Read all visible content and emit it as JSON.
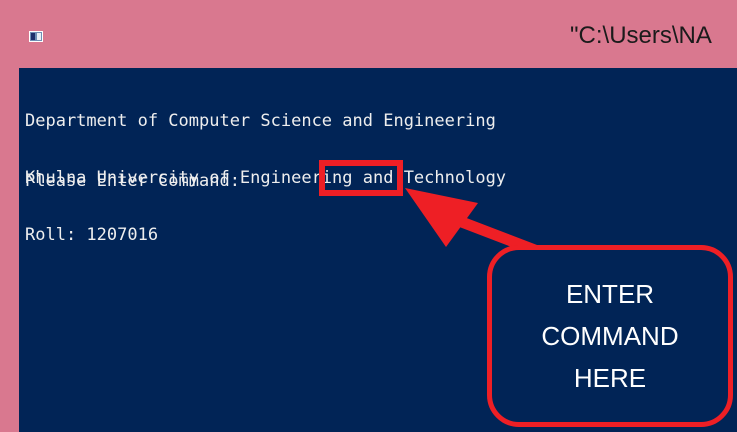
{
  "window": {
    "title": "\"C:\\Users\\NA",
    "icon": "console-app-icon"
  },
  "console": {
    "lines": [
      "Department of Computer Science and Engineering",
      "Khulna University of Engineering and Technology",
      "Roll: 1207016"
    ],
    "prompt": "Please Enter Command:",
    "input_value": ""
  },
  "callout": {
    "line1": "ENTER",
    "line2": "COMMAND",
    "line3": "HERE"
  },
  "colors": {
    "title_bar": "#d9788f",
    "console_background": "#012456",
    "console_text": "#eeeeee",
    "annotation_red": "#ee1f25",
    "callout_text": "#ffffff"
  }
}
